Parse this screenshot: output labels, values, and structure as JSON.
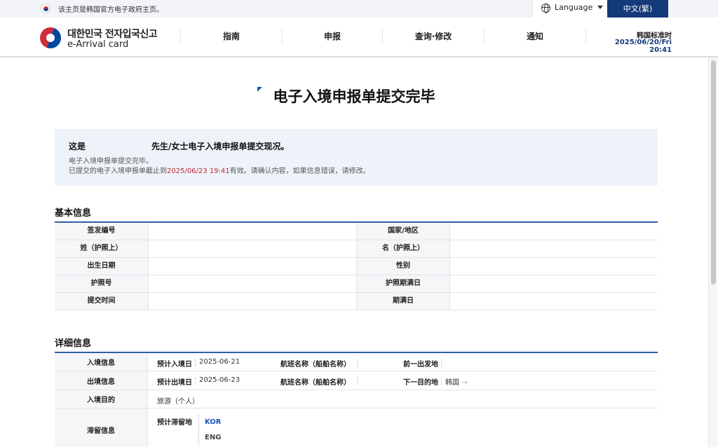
{
  "topbar": {
    "notice": "该主页是韩国官方电子政府主页。",
    "language_label": "Language",
    "current_language": "中文(繁)"
  },
  "header": {
    "logo_kr": "대한민국 전자입국신고",
    "logo_en": "e-Arrival card",
    "nav": [
      "指南",
      "申报",
      "查询·修改",
      "通知"
    ],
    "time_title": "韩国标准时",
    "time_value": "2025/06/20/Fri 20:41"
  },
  "page": {
    "title": "电子入境申报单提交完毕"
  },
  "info": {
    "heading_prefix": "这是",
    "heading_suffix": "先生/女士电子入境申报单提交现况。",
    "line1": "电子入境申报单提交完毕。",
    "line2_prefix": "已提交的电子入境申报单截止到",
    "line2_date": "2025/06/23 19:41",
    "line2_suffix": "有效。请确认内容，如果信息错误，请修改。"
  },
  "basic": {
    "title": "基本信息",
    "rows": [
      {
        "left_label": "签发编号",
        "left_value": "",
        "right_label": "国家/地区",
        "right_value": ""
      },
      {
        "left_label": "姓（护照上）",
        "left_value": "",
        "right_label": "名（护照上）",
        "right_value": ""
      },
      {
        "left_label": "出生日期",
        "left_value": "",
        "right_label": "性别",
        "right_value": ""
      },
      {
        "left_label": "护照号",
        "left_value": "",
        "right_label": "护照期满日",
        "right_value": ""
      },
      {
        "left_label": "提交时间",
        "left_value": "",
        "right_label": "期满日",
        "right_value": ""
      }
    ]
  },
  "detail": {
    "title": "详细信息",
    "entry": {
      "label": "入境信息",
      "date_key": "预计入境日",
      "date_value": "2025-06-21",
      "flight_key": "航班名称（船舶名称）",
      "flight_value": "",
      "from_key": "前一出发地",
      "from_value": ""
    },
    "exit": {
      "label": "出境信息",
      "date_key": "预计出境日",
      "date_value": "2025-06-23",
      "flight_key": "航班名称（船舶名称）",
      "flight_value": "",
      "to_key": "下一目的地",
      "to_value": "韩国",
      "to_arrow": "→"
    },
    "purpose": {
      "label": "入境目的",
      "value": "旅游（个人）"
    },
    "stay": {
      "label": "滞留信息",
      "key": "预计滞留地",
      "tag_kor": "KOR",
      "tag_eng": "ENG"
    }
  }
}
